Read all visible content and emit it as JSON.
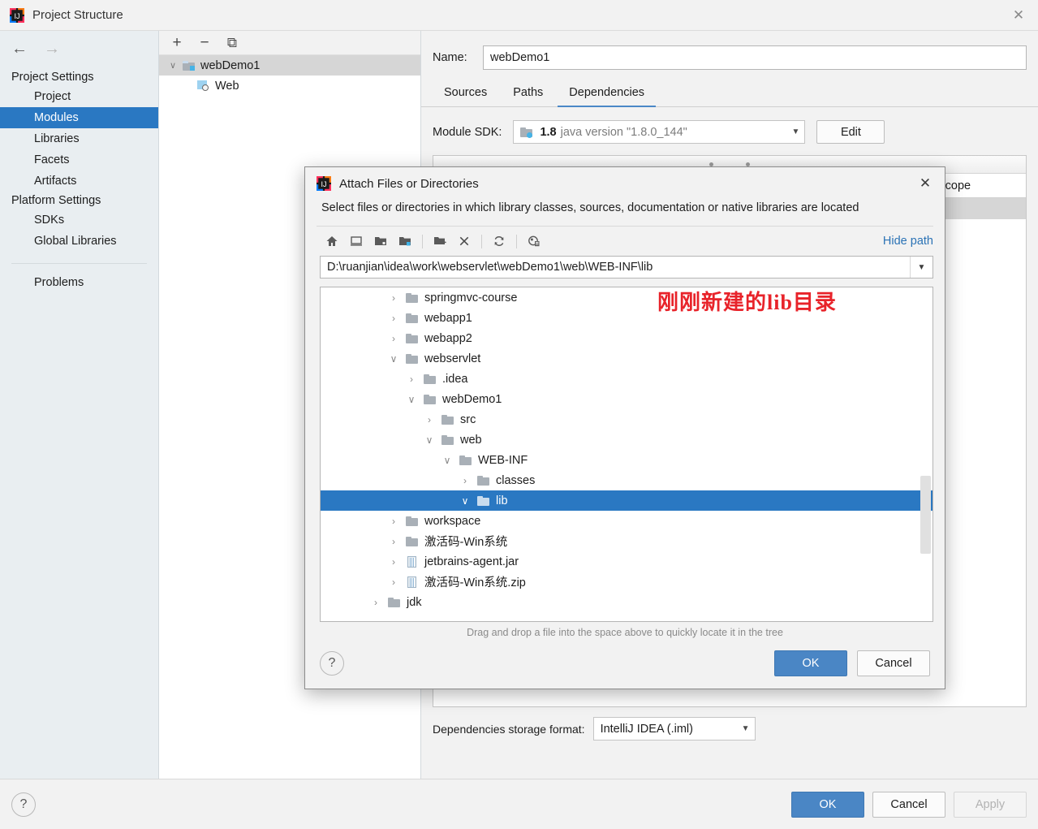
{
  "window": {
    "title": "Project Structure",
    "app_icon": "intellij-idea-icon",
    "close_icon": "✕"
  },
  "sidebar": {
    "back_icon": "←",
    "forward_icon": "→",
    "groups": [
      {
        "label": "Project Settings",
        "items": [
          {
            "label": "Project",
            "selected": false
          },
          {
            "label": "Modules",
            "selected": true
          },
          {
            "label": "Libraries",
            "selected": false
          },
          {
            "label": "Facets",
            "selected": false
          },
          {
            "label": "Artifacts",
            "selected": false
          }
        ]
      },
      {
        "label": "Platform Settings",
        "items": [
          {
            "label": "SDKs",
            "selected": false
          },
          {
            "label": "Global Libraries",
            "selected": false
          }
        ]
      }
    ],
    "problems_label": "Problems"
  },
  "module_panel": {
    "toolbar": [
      {
        "name": "add-module-button",
        "glyph": "+"
      },
      {
        "name": "remove-module-button",
        "glyph": "−"
      },
      {
        "name": "copy-module-button",
        "glyph": "⧉"
      }
    ],
    "tree": [
      {
        "label": "webDemo1",
        "expander": "⌄",
        "icon": "module-folder-icon",
        "selected": true,
        "indent": 0
      },
      {
        "label": "Web",
        "expander": "",
        "icon": "web-facet-icon",
        "selected": false,
        "indent": 1
      }
    ]
  },
  "details": {
    "name_label": "Name:",
    "name_value": "webDemo1",
    "tabs": [
      {
        "label": "Sources",
        "active": false
      },
      {
        "label": "Paths",
        "active": false
      },
      {
        "label": "Dependencies",
        "active": true
      }
    ],
    "module_sdk_label": "Module SDK:",
    "module_sdk_value_bold": "1.8",
    "module_sdk_value_rest": "java version \"1.8.0_144\"",
    "edit_button": "Edit",
    "dependencies_columns": [
      "Scope"
    ],
    "storage_label": "Dependencies storage format:",
    "storage_value": "IntelliJ IDEA (.iml)"
  },
  "footer": {
    "help_glyph": "?",
    "ok": "OK",
    "cancel": "Cancel",
    "apply": "Apply"
  },
  "dialog": {
    "title": "Attach Files or Directories",
    "icon": "intellij-idea-icon",
    "close_icon": "✕",
    "description": "Select files or directories in which library classes, sources, documentation or native libraries are located",
    "toolbar": [
      {
        "name": "home-icon",
        "glyph": "home"
      },
      {
        "name": "desktop-icon",
        "glyph": "desktop"
      },
      {
        "name": "project-folder-icon",
        "glyph": "project"
      },
      {
        "name": "module-folder-icon",
        "glyph": "module"
      },
      {
        "name": "new-folder-icon",
        "glyph": "newfolder"
      },
      {
        "name": "delete-icon",
        "glyph": "delete"
      },
      {
        "name": "refresh-icon",
        "glyph": "refresh"
      },
      {
        "name": "show-hidden-files-icon",
        "glyph": "hidden"
      }
    ],
    "hide_path_label": "Hide path",
    "path_value": "D:\\ruanjian\\idea\\work\\webservlet\\webDemo1\\web\\WEB-INF\\lib",
    "path_dropdown_icon": "▼",
    "tree": [
      {
        "label": "springmvc-course",
        "indent": 2,
        "expander": "collapsed",
        "icon": "folder",
        "selected": false
      },
      {
        "label": "webapp1",
        "indent": 2,
        "expander": "collapsed",
        "icon": "folder",
        "selected": false
      },
      {
        "label": "webapp2",
        "indent": 2,
        "expander": "collapsed",
        "icon": "folder",
        "selected": false
      },
      {
        "label": "webservlet",
        "indent": 2,
        "expander": "expanded",
        "icon": "folder",
        "selected": false
      },
      {
        "label": ".idea",
        "indent": 3,
        "expander": "collapsed",
        "icon": "folder",
        "selected": false
      },
      {
        "label": "webDemo1",
        "indent": 3,
        "expander": "expanded",
        "icon": "folder",
        "selected": false
      },
      {
        "label": "src",
        "indent": 4,
        "expander": "collapsed",
        "icon": "folder",
        "selected": false
      },
      {
        "label": "web",
        "indent": 4,
        "expander": "expanded",
        "icon": "folder",
        "selected": false
      },
      {
        "label": "WEB-INF",
        "indent": 5,
        "expander": "expanded",
        "icon": "folder",
        "selected": false
      },
      {
        "label": "classes",
        "indent": 6,
        "expander": "collapsed",
        "icon": "folder",
        "selected": false
      },
      {
        "label": "lib",
        "indent": 6,
        "expander": "expanded",
        "icon": "folder",
        "selected": true
      },
      {
        "label": "workspace",
        "indent": 2,
        "expander": "collapsed",
        "icon": "folder",
        "selected": false
      },
      {
        "label": "激活码-Win系统",
        "indent": 2,
        "expander": "collapsed",
        "icon": "folder",
        "selected": false
      },
      {
        "label": "jetbrains-agent.jar",
        "indent": 2,
        "expander": "collapsed",
        "icon": "jar",
        "selected": false
      },
      {
        "label": "激活码-Win系统.zip",
        "indent": 2,
        "expander": "collapsed",
        "icon": "jar",
        "selected": false
      },
      {
        "label": "jdk",
        "indent": 1,
        "expander": "collapsed",
        "icon": "folder",
        "selected": false
      }
    ],
    "annotation": "刚刚新建的lib目录",
    "annotation_color": "#e8232a",
    "drag_hint": "Drag and drop a file into the space above to quickly locate it in the tree",
    "help_glyph": "?",
    "ok": "OK",
    "cancel": "Cancel"
  },
  "colors": {
    "accent_blue": "#2a78c2",
    "button_blue": "#4a86c5",
    "sidebar_bg": "#e9eef1",
    "link_blue": "#2a72b5"
  }
}
